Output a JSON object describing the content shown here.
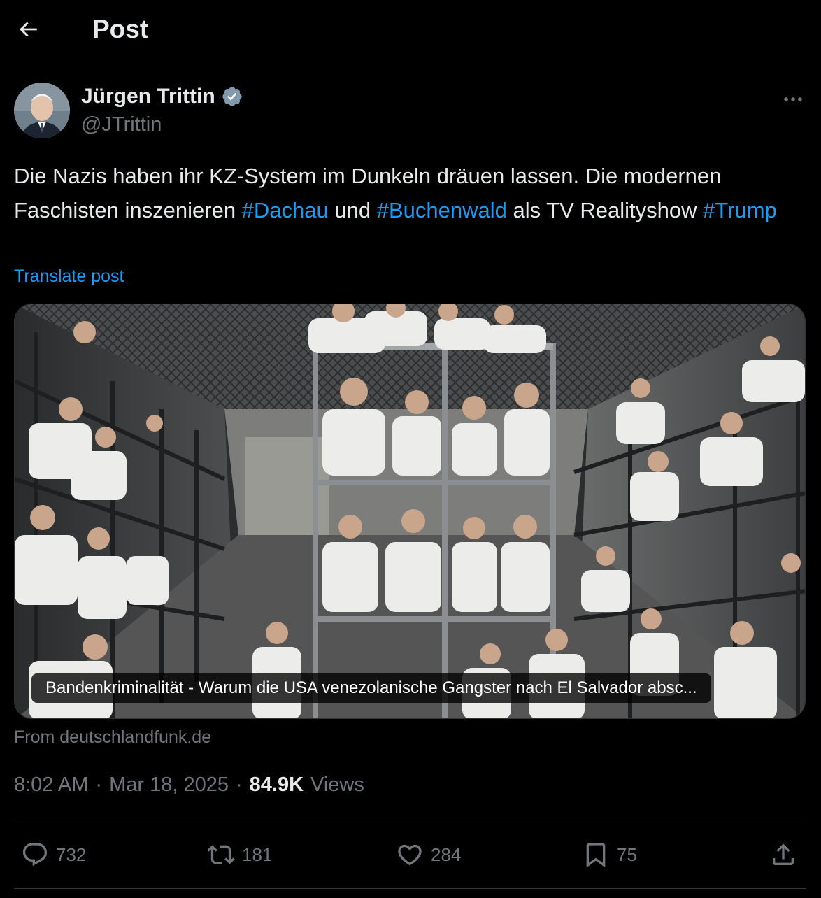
{
  "header": {
    "title": "Post",
    "back_icon": "arrow-left-icon"
  },
  "author": {
    "display_name": "Jürgen Trittin",
    "handle": "@JTrittin",
    "verified": true,
    "verified_icon": "verified-badge-icon"
  },
  "post": {
    "text_parts": [
      {
        "text": "Die Nazis haben ihr KZ-System im Dunkeln dräuen lassen. Die modernen Faschisten inszenieren ",
        "hashtag": false
      },
      {
        "text": "#Dachau",
        "hashtag": true
      },
      {
        "text": " und ",
        "hashtag": false
      },
      {
        "text": "#Buchenwald",
        "hashtag": true
      },
      {
        "text": " als TV Realityshow ",
        "hashtag": false
      },
      {
        "text": "#Trump",
        "hashtag": true
      }
    ],
    "translate_label": "Translate post"
  },
  "card": {
    "caption": "Bandenkriminalität - Warum die USA venezolanische Gangster nach El Salvador absc...",
    "source": "From deutschlandfunk.de"
  },
  "meta": {
    "time": "8:02 AM",
    "separator": "·",
    "date": "Mar 18, 2025",
    "views_count": "84.9K",
    "views_label": "Views"
  },
  "actions": {
    "replies": "732",
    "reposts": "181",
    "likes": "284",
    "bookmarks": "75"
  },
  "colors": {
    "background": "#000000",
    "text": "#e7e9ea",
    "muted": "#71767b",
    "accent": "#1d9bf0",
    "divider": "#2f3336"
  }
}
